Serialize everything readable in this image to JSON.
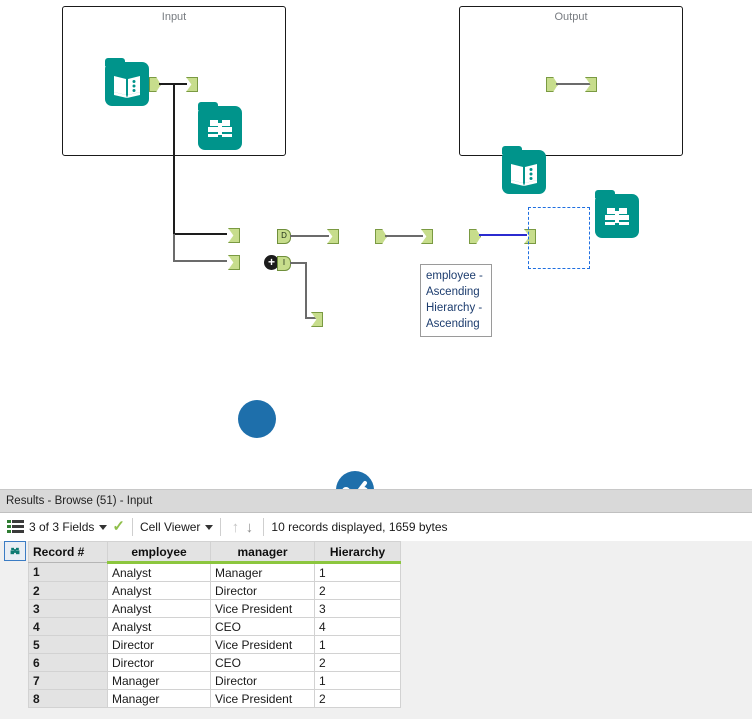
{
  "canvas": {
    "containers": [
      {
        "name": "input-container",
        "title": "Input"
      },
      {
        "name": "output-container",
        "title": "Output"
      }
    ],
    "tools": {
      "input_data_icon": "book-icon",
      "browse_icon": "binoculars-icon",
      "join_icon": "join-circle-icon",
      "select_icon": "select-check-icon",
      "sort_icon": "sort-dots-icon"
    },
    "anchor_labels": {
      "join_output_d": "D",
      "join_output_i": "I"
    },
    "join_badge": "+",
    "sort_annotation": "employee - Ascending\nHierarchy - Ascending"
  },
  "results": {
    "title": "Results - Browse (51) - Input",
    "toolbar": {
      "fields_label": "3 of 3 Fields",
      "view_label": "Cell Viewer",
      "status": "10 records displayed, 1659 bytes",
      "fields_icon": "field-list-icon",
      "check_icon": "check-icon",
      "up_icon": "arrow-up-icon",
      "down_icon": "arrow-down-icon",
      "caret_icon": "chevron-down-icon"
    },
    "table": {
      "columns": [
        "Record #",
        "employee",
        "manager",
        "Hierarchy"
      ],
      "rows": [
        [
          "1",
          "Analyst",
          "Manager",
          "1"
        ],
        [
          "2",
          "Analyst",
          "Director",
          "2"
        ],
        [
          "3",
          "Analyst",
          "Vice President",
          "3"
        ],
        [
          "4",
          "Analyst",
          "CEO",
          "4"
        ],
        [
          "5",
          "Director",
          "Vice President",
          "1"
        ],
        [
          "6",
          "Director",
          "CEO",
          "2"
        ],
        [
          "7",
          "Manager",
          "Director",
          "1"
        ],
        [
          "8",
          "Manager",
          "Vice President",
          "2"
        ]
      ]
    }
  },
  "colors": {
    "teal": "#00948b",
    "blue": "#1e6fab",
    "anchor_green": "#c7dd8c",
    "header_underline": "#8cc63e",
    "selection": "#1f6fe0",
    "highlight_wire": "#2b2bd0"
  }
}
